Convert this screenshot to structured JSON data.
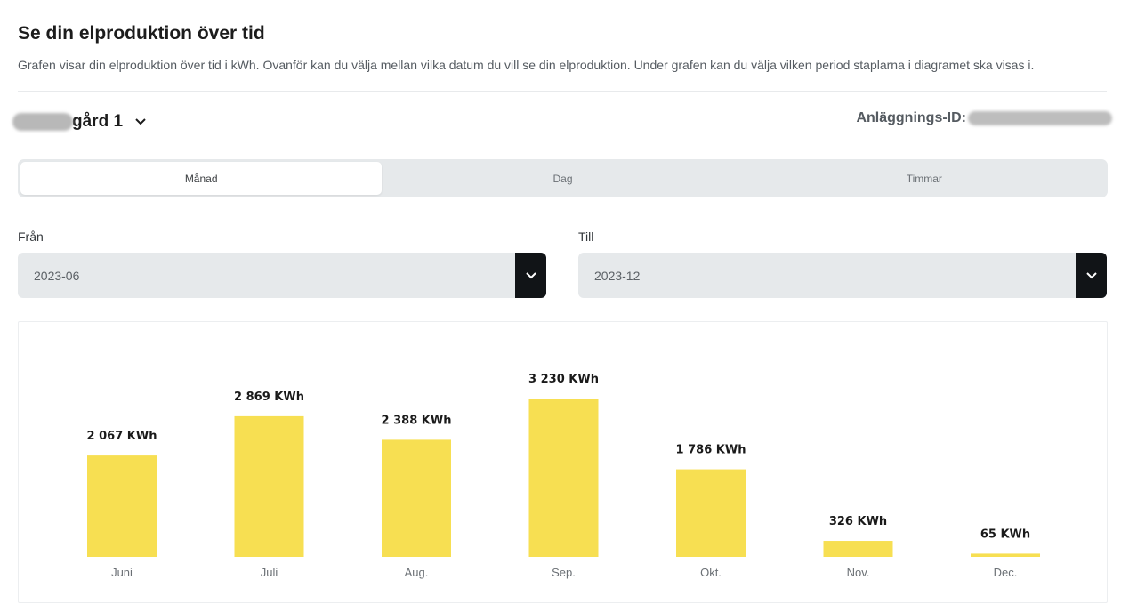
{
  "header": {
    "title": "Se din elproduktion över tid",
    "description": "Grafen visar din elproduktion över tid i kWh. Ovanför kan du välja mellan vilka datum du vill se din elproduktion. Under grafen kan du välja vilken period staplarna i diagramet ska visas i."
  },
  "site": {
    "name": "gård 1"
  },
  "facility": {
    "label": "Anläggnings-ID:"
  },
  "period_tabs": [
    {
      "label": "Månad",
      "active": true
    },
    {
      "label": "Dag",
      "active": false
    },
    {
      "label": "Timmar",
      "active": false
    }
  ],
  "range": {
    "from_label": "Från",
    "from_value": "2023-06",
    "to_label": "Till",
    "to_value": "2023-12"
  },
  "colors": {
    "bar": "#f7df52",
    "selectButton": "#111417"
  },
  "icons": {
    "site_chevron": "chevron-down-icon",
    "select_chevron": "chevron-down-icon"
  },
  "chart_data": {
    "type": "bar",
    "categories": [
      "Juni",
      "Juli",
      "Aug.",
      "Sep.",
      "Okt.",
      "Nov.",
      "Dec."
    ],
    "values": [
      2067,
      2869,
      2388,
      3230,
      1786,
      326,
      65
    ],
    "value_labels": [
      "2 067 KWh",
      "2 869 KWh",
      "2 388 KWh",
      "3 230 KWh",
      "1 786 KWh",
      "326 KWh",
      "65 KWh"
    ],
    "unit": "KWh",
    "ylim": [
      0,
      3230
    ],
    "grid": false,
    "legend": "none"
  }
}
